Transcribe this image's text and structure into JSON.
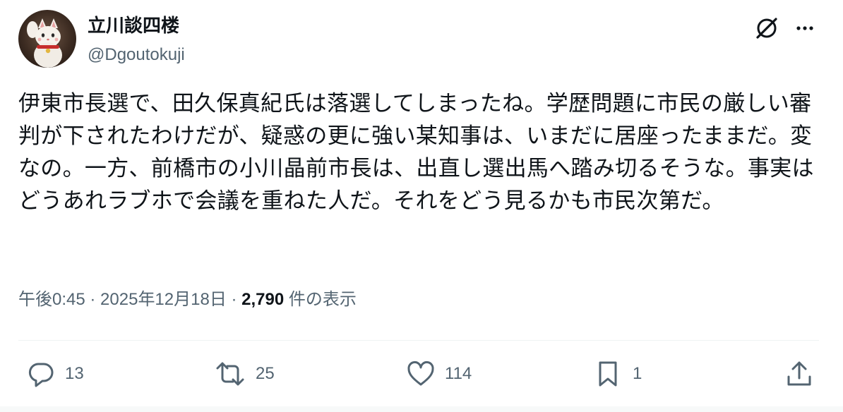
{
  "author": {
    "display_name": "立川談四楼",
    "handle": "@Dgoutokuji",
    "avatar_icon": "maneki-neko-avatar"
  },
  "header_actions": {
    "grok_icon": "grok-slash-icon",
    "more_icon": "more-dots-icon"
  },
  "post": {
    "text": "伊東市長選で、田久保真紀氏は落選してしまったね。学歴問題に市民の厳しい審判が下されたわけだが、疑惑の更に強い某知事は、いまだに居座ったままだ。変なの。一方、前橋市の小川晶前市長は、出直し選出馬へ踏み切るそうな。事実はどうあれラブホで会議を重ねた人だ。それをどう見るかも市民次第だ。"
  },
  "meta": {
    "time": "午後0:45",
    "separator1": " · ",
    "date": "2025年12月18日",
    "separator2": " · ",
    "views_count": "2,790",
    "views_label": " 件の表示"
  },
  "actions": {
    "replies": "13",
    "retweets": "25",
    "likes": "114",
    "bookmarks": "1"
  },
  "colors": {
    "text": "#0f1419",
    "secondary": "#536471",
    "divider": "#eff3f4"
  }
}
